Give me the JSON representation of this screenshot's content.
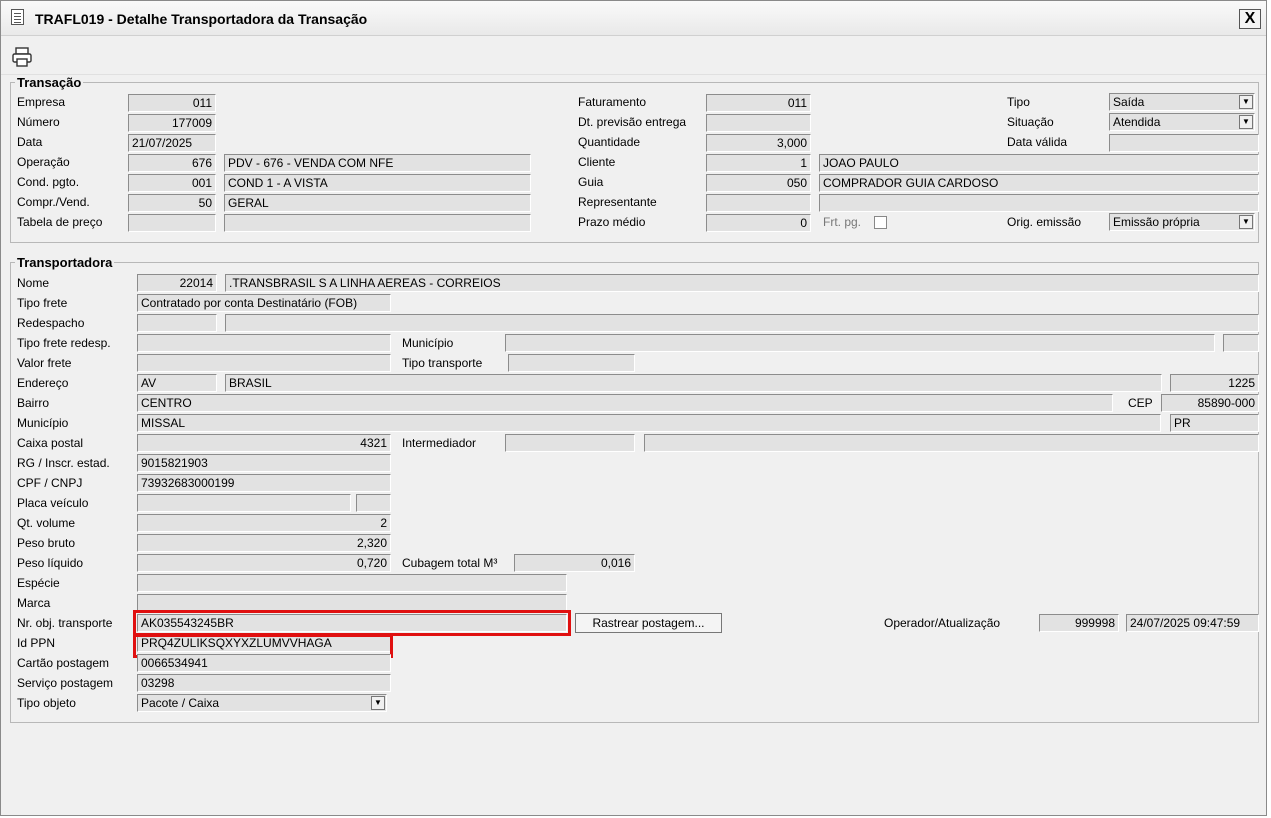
{
  "window": {
    "title": "TRAFL019 - Detalhe Transportadora da Transação",
    "close_label": "X"
  },
  "toolbar": {
    "print_icon": "printer-icon"
  },
  "transacao": {
    "legend": "Transação",
    "empresa_label": "Empresa",
    "empresa": "011",
    "numero_label": "Número",
    "numero": "177009",
    "data_label": "Data",
    "data": "21/07/2025",
    "operacao_label": "Operação",
    "operacao_cod": "676",
    "operacao_desc": "PDV - 676 - VENDA COM NFE",
    "cond_label": "Cond. pgto.",
    "cond_cod": "001",
    "cond_desc": "COND 1 - A VISTA",
    "compr_label": "Compr./Vend.",
    "compr_cod": "50",
    "compr_desc": "GERAL",
    "tabela_label": "Tabela de preço",
    "tabela_cod": "",
    "tabela_desc": "",
    "faturamento_label": "Faturamento",
    "faturamento": "011",
    "previsao_label": "Dt. previsão entrega",
    "previsao": "",
    "quantidade_label": "Quantidade",
    "quantidade": "3,000",
    "cliente_label": "Cliente",
    "cliente_cod": "1",
    "cliente_nome": "JOAO PAULO",
    "guia_label": "Guia",
    "guia_cod": "050",
    "guia_nome": "COMPRADOR GUIA CARDOSO",
    "representante_label": "Representante",
    "representante_cod": "",
    "representante_nome": "",
    "prazo_label": "Prazo médio",
    "prazo": "0",
    "frtpg_label": "Frt. pg.",
    "tipo_label": "Tipo",
    "tipo": "Saída",
    "situacao_label": "Situação",
    "situacao": "Atendida",
    "datavalida_label": "Data válida",
    "datavalida": "",
    "origem_label": "Orig. emissão",
    "origem": "Emissão própria"
  },
  "transportadora": {
    "legend": "Transportadora",
    "nome_label": "Nome",
    "nome_cod": "22014",
    "nome": ".TRANSBRASIL S A LINHA AEREAS - CORREIOS",
    "tipofrete_label": "Tipo frete",
    "tipofrete": "Contratado por conta Destinatário (FOB)",
    "redespacho_label": "Redespacho",
    "redespacho_cod": "",
    "redespacho_nome": "",
    "tipofreteredesp_label": "Tipo frete redesp.",
    "tipofreteredesp": "",
    "municipio_top_label": "Município",
    "municipio_top": "",
    "municipio_top_uf": "",
    "valorfrete_label": "Valor frete",
    "valorfrete": "",
    "tipotransporte_label": "Tipo transporte",
    "tipotransporte": "",
    "endereco_label": "Endereço",
    "endereco_tipo": "AV",
    "endereco": "BRASIL",
    "endereco_num": "1225",
    "bairro_label": "Bairro",
    "bairro": "CENTRO",
    "cep_label": "CEP",
    "cep": "85890-000",
    "municipio_label": "Município",
    "municipio": "MISSAL",
    "uf": "PR",
    "caixapostal_label": "Caixa postal",
    "caixapostal": "4321",
    "intermediador_label": "Intermediador",
    "intermediador_cod": "",
    "intermediador_nome": "",
    "rg_label": "RG / Inscr. estad.",
    "rg": "9015821903",
    "cpf_label": "CPF / CNPJ",
    "cpf": "73932683000199",
    "placa_label": "Placa veículo",
    "placa": "",
    "placa_uf": "",
    "qtvolume_label": "Qt. volume",
    "qtvolume": "2",
    "pesobruto_label": "Peso bruto",
    "pesobruto": "2,320",
    "pesoliquido_label": "Peso líquido",
    "pesoliquido": "0,720",
    "cubagem_label": "Cubagem total M³",
    "cubagem": "0,016",
    "especie_label": "Espécie",
    "especie": "",
    "marca_label": "Marca",
    "marca": "",
    "nrobj_label": "Nr. obj. transporte",
    "nrobj": "AK035543245BR",
    "rastrear_label": "Rastrear postagem...",
    "operador_label": "Operador/Atualização",
    "operador": "999998",
    "atualizacao": "24/07/2025 09:47:59",
    "idppn_label": "Id PPN",
    "idppn": "PRQ4ZULIKSQXYXZLUMVVHAGA",
    "cartao_label": "Cartão postagem",
    "cartao": "0066534941",
    "servico_label": "Serviço postagem",
    "servico": "03298",
    "tipoobjeto_label": "Tipo objeto",
    "tipoobjeto": "Pacote / Caixa"
  },
  "highlight_color": "#e01010"
}
